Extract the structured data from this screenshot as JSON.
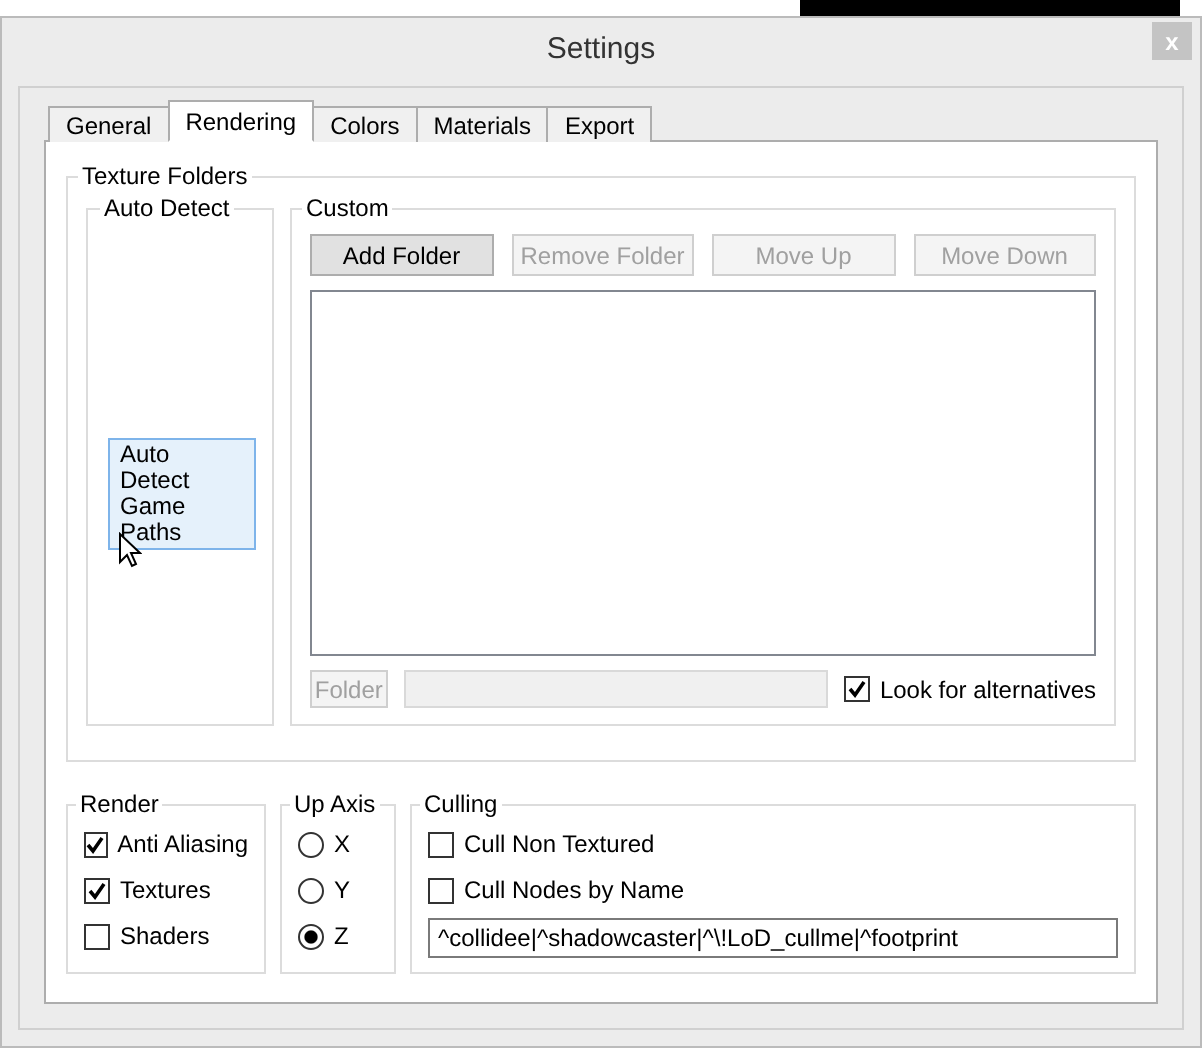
{
  "window": {
    "title": "Settings",
    "close": "x"
  },
  "tabs": [
    {
      "label": "General",
      "selected": false
    },
    {
      "label": "Rendering",
      "selected": true
    },
    {
      "label": "Colors",
      "selected": false
    },
    {
      "label": "Materials",
      "selected": false
    },
    {
      "label": "Export",
      "selected": false
    }
  ],
  "texture_folders": {
    "title": "Texture Folders",
    "auto_detect": {
      "title": "Auto Detect",
      "button": "Auto Detect Game Paths"
    },
    "custom": {
      "title": "Custom",
      "buttons": [
        {
          "label": "Add Folder",
          "disabled": false
        },
        {
          "label": "Remove Folder",
          "disabled": true
        },
        {
          "label": "Move Up",
          "disabled": true
        },
        {
          "label": "Move Down",
          "disabled": true
        }
      ],
      "folder_button": {
        "label": "Folder",
        "disabled": true
      },
      "look_for_alternatives": {
        "label": "Look for alternatives",
        "checked": true
      }
    }
  },
  "render": {
    "title": "Render",
    "options": [
      {
        "label": "Anti Aliasing",
        "checked": true
      },
      {
        "label": "Textures",
        "checked": true
      },
      {
        "label": "Shaders",
        "checked": false
      }
    ]
  },
  "up_axis": {
    "title": "Up Axis",
    "options": [
      {
        "label": "X",
        "selected": false
      },
      {
        "label": "Y",
        "selected": false
      },
      {
        "label": "Z",
        "selected": true
      }
    ]
  },
  "culling": {
    "title": "Culling",
    "options": [
      {
        "label": "Cull Non Textured",
        "checked": false
      },
      {
        "label": "Cull Nodes by Name",
        "checked": false
      }
    ],
    "filter": "^collidee|^shadowcaster|^\\!LoD_cullme|^footprint"
  }
}
